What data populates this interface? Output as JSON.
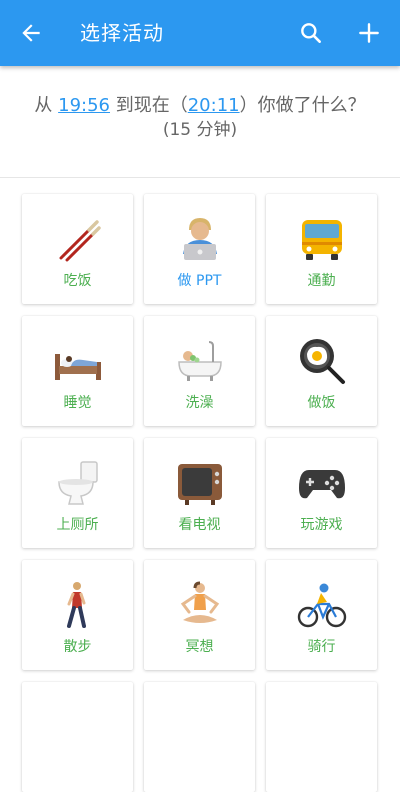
{
  "appbar": {
    "title": "选择活动"
  },
  "prompt": {
    "prefix": "从 ",
    "start_time": "19:56",
    "middle": " 到现在（",
    "end_time": "20:11",
    "suffix": "）你做了什么？",
    "duration": "(15 分钟)"
  },
  "activities": [
    {
      "label": "吃饭",
      "icon": "chopsticks-icon"
    },
    {
      "label": "做 PPT",
      "icon": "laptop-person-icon"
    },
    {
      "label": "通勤",
      "icon": "bus-icon"
    },
    {
      "label": "睡觉",
      "icon": "bed-icon"
    },
    {
      "label": "洗澡",
      "icon": "bathtub-icon"
    },
    {
      "label": "做饭",
      "icon": "frying-pan-icon"
    },
    {
      "label": "上厕所",
      "icon": "toilet-icon"
    },
    {
      "label": "看电视",
      "icon": "television-icon"
    },
    {
      "label": "玩游戏",
      "icon": "gamepad-icon"
    },
    {
      "label": "散步",
      "icon": "walking-person-icon"
    },
    {
      "label": "冥想",
      "icon": "meditation-icon"
    },
    {
      "label": "骑行",
      "icon": "cyclist-icon"
    }
  ],
  "colors": {
    "appbar": "#2c98f0",
    "label_green": "#4caf50",
    "label_blue": "#2c98f0"
  }
}
